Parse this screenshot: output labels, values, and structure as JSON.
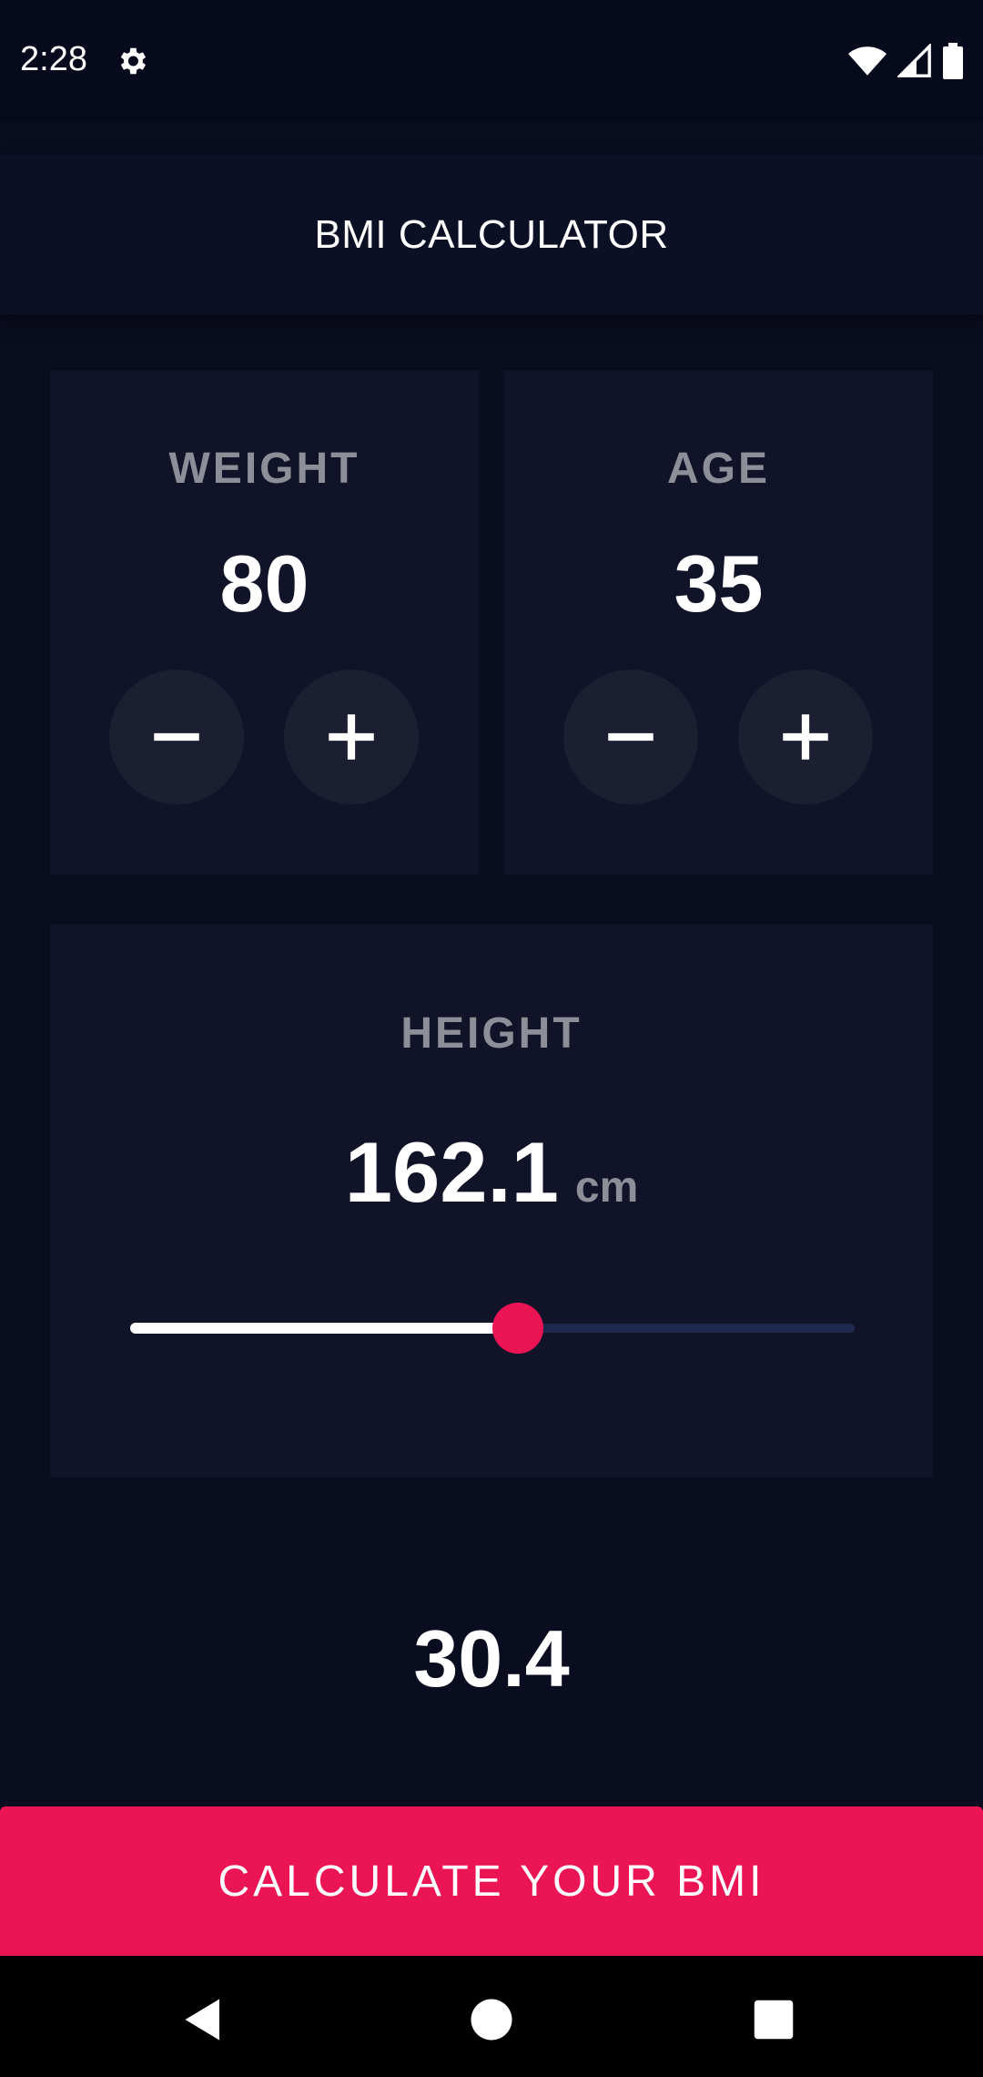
{
  "status_bar": {
    "time": "2:28",
    "icons": [
      "gear-icon",
      "wifi-icon",
      "signal-icon",
      "battery-icon"
    ]
  },
  "app_bar": {
    "title": "BMI CALCULATOR"
  },
  "weight": {
    "label": "WEIGHT",
    "value": "80"
  },
  "age": {
    "label": "AGE",
    "value": "35"
  },
  "height": {
    "label": "HEIGHT",
    "value": "162.1",
    "unit": "cm",
    "slider_fraction": 0.535
  },
  "bmi": {
    "result": "30.4"
  },
  "calculate_button": {
    "label": "CALCULATE YOUR BMI"
  },
  "colors": {
    "background": "#0a0d1f",
    "card": "#111429",
    "round_button": "#1c1f32",
    "accent": "#eb1555",
    "label_gray": "#8d8e98"
  },
  "nav_bar": {
    "buttons": [
      "back-icon",
      "home-icon",
      "recents-icon"
    ]
  }
}
